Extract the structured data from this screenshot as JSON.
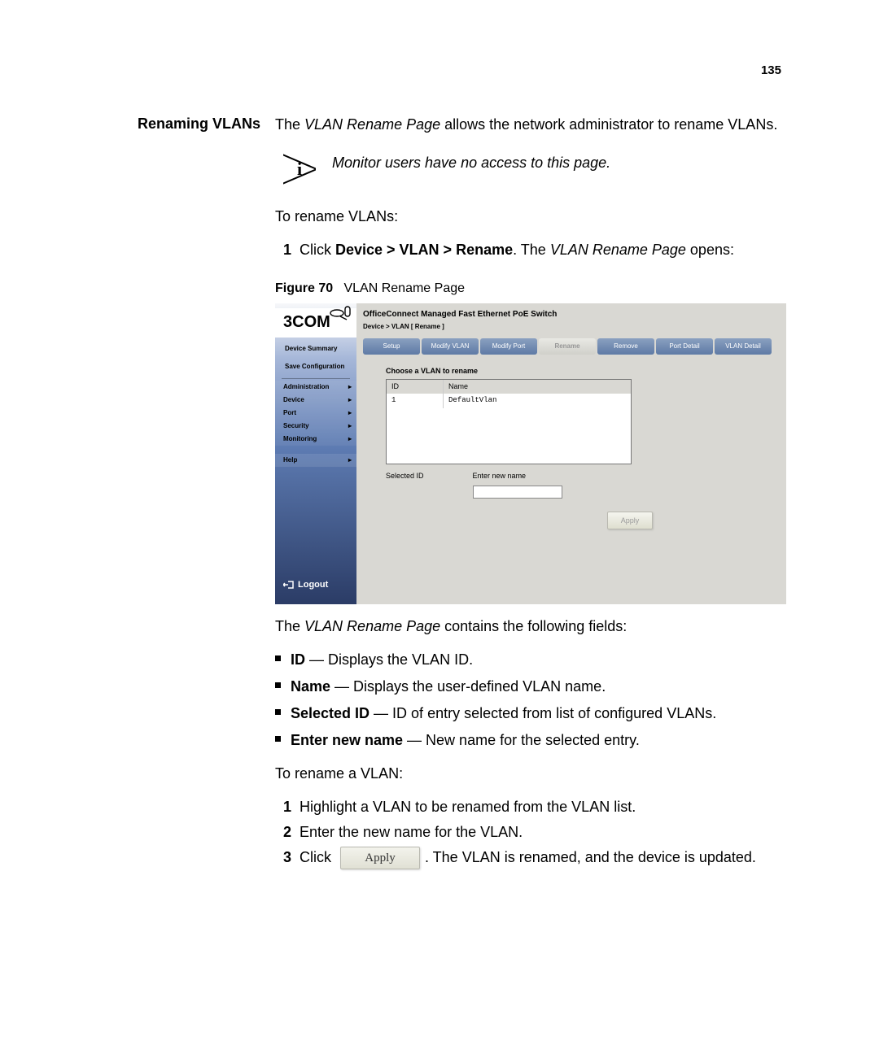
{
  "page_number": "135",
  "section_title": "Renaming VLANs",
  "intro_prefix": "The ",
  "intro_pagename": "VLAN Rename Page",
  "intro_suffix": " allows the network administrator to rename VLANs.",
  "note_text": "Monitor users have no access to this page.",
  "to_rename_title": "To rename VLANs:",
  "step1": {
    "num": "1",
    "pre": "Click ",
    "path": "Device > VLAN > Rename",
    "mid": ". The ",
    "pagename": "VLAN Rename Page",
    "post": " opens:"
  },
  "figure": {
    "label": "Figure 70",
    "caption": "VLAN Rename Page"
  },
  "screenshot": {
    "brand": "3COM",
    "title": "OfficeConnect Managed Fast Ethernet PoE Switch",
    "breadcrumb": "Device > VLAN [ Rename ]",
    "sidebar_top": [
      "Device Summary",
      "Save Configuration"
    ],
    "sidebar_items": [
      "Administration",
      "Device",
      "Port",
      "Security",
      "Monitoring"
    ],
    "sidebar_help": "Help",
    "logout": "Logout",
    "tabs": [
      "Setup",
      "Modify VLAN",
      "Modify Port",
      "Rename",
      "Remove",
      "Port Detail",
      "VLAN Detail"
    ],
    "active_tab_index": 3,
    "panel_title": "Choose a VLAN to rename",
    "cols": {
      "id": "ID",
      "name": "Name"
    },
    "rows": [
      {
        "id": "1",
        "name": "DefaultVlan"
      }
    ],
    "selected_id_label": "Selected ID",
    "enter_name_label": "Enter new name",
    "apply_btn": "Apply"
  },
  "fields_intro_pre": "The ",
  "fields_intro_name": "VLAN Rename Page",
  "fields_intro_post": " contains the following fields:",
  "fields": [
    {
      "label": "ID",
      "desc": " — Displays the VLAN ID."
    },
    {
      "label": "Name",
      "desc": " — Displays the user-defined VLAN name."
    },
    {
      "label": "Selected ID",
      "desc": " — ID of entry selected from list of configured VLANs."
    },
    {
      "label": "Enter new name",
      "desc": " — New name for the selected entry."
    }
  ],
  "to_rename_vlan": "To rename a VLAN:",
  "steps2": [
    {
      "num": "1",
      "text": "Highlight a VLAN to be renamed from the VLAN list."
    },
    {
      "num": "2",
      "text": "Enter the new name for the VLAN."
    }
  ],
  "step3": {
    "num": "3",
    "pre": "Click ",
    "btn": "Apply",
    "post": ". The VLAN is renamed, and the device is updated."
  }
}
